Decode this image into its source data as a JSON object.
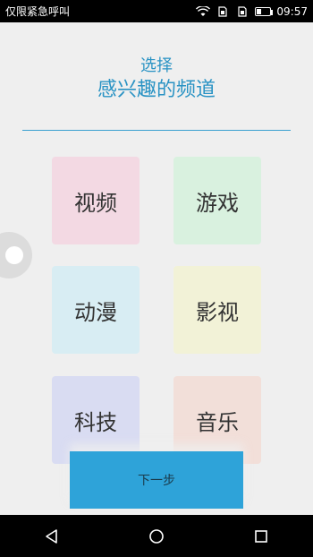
{
  "status_bar": {
    "carrier_text": "仅限紧急呼叫",
    "time": "09:57",
    "icons": [
      "wifi-icon",
      "sim-card-icon",
      "sim-card-icon",
      "battery-icon"
    ]
  },
  "header": {
    "line1": "选择",
    "line2": "感兴趣的频道"
  },
  "channels": [
    {
      "label": "视频",
      "color": "#f3d9e3"
    },
    {
      "label": "游戏",
      "color": "#d9f1df"
    },
    {
      "label": "动漫",
      "color": "#d8edf3"
    },
    {
      "label": "影视",
      "color": "#f2f2d7"
    },
    {
      "label": "科技",
      "color": "#d9dcf2"
    },
    {
      "label": "音乐",
      "color": "#f2dfd9"
    }
  ],
  "next_button": {
    "label": "下一步",
    "color": "#2ea3d9"
  },
  "nav_bar": {
    "icons": [
      "back-icon",
      "home-icon",
      "recents-icon"
    ]
  },
  "colors": {
    "accent": "#2a93c4",
    "background": "#efefef"
  }
}
